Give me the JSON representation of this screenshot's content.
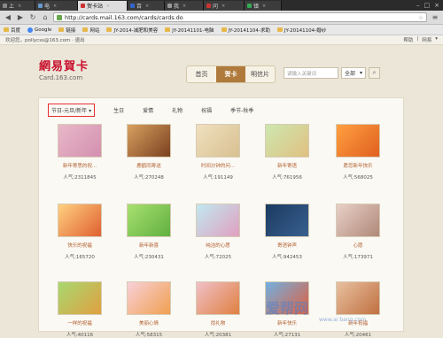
{
  "browser": {
    "tabs": [
      {
        "label": "上",
        "favicon_color": "#888888",
        "active": false
      },
      {
        "label": "电",
        "favicon_color": "#6699cc",
        "active": false
      },
      {
        "label": "贺卡站",
        "favicon_color": "#cc3333",
        "active": true
      },
      {
        "label": "百",
        "favicon_color": "#3366cc",
        "active": false
      },
      {
        "label": "我",
        "favicon_color": "#999999",
        "active": false
      },
      {
        "label": "问",
        "favicon_color": "#cc3333",
        "active": false
      },
      {
        "label": "镇",
        "favicon_color": "#33aa55",
        "active": false
      }
    ],
    "url": "http://cards.mail.163.com/cards/cards.do",
    "bookmarks": [
      {
        "label": "百度",
        "icon": "folder-icon"
      },
      {
        "label": "Google",
        "icon": "google-icon"
      },
      {
        "label": "链接",
        "icon": "folder-icon"
      },
      {
        "label": "网站",
        "icon": "folder-icon"
      },
      {
        "label": "JY-2014-减肥和美容",
        "icon": "folder-icon"
      },
      {
        "label": "JY-20141101-电脑",
        "icon": "folder-icon"
      },
      {
        "label": "JY-20141104-求助",
        "icon": "folder-icon"
      },
      {
        "label": "JY-20141104-婚纱",
        "icon": "folder-icon"
      }
    ]
  },
  "page": {
    "welcome": "欢迎您，pollycss@163.com · 退出",
    "top_links": [
      "帮助",
      "|",
      "网易",
      "▾"
    ],
    "logo_text": "網易賀卡",
    "logo_domain": "Card.163.com",
    "nav": [
      "首页",
      "贺卡",
      "明信片"
    ],
    "active_nav": 1,
    "search_placeholder": "请输入关键词",
    "search_scope": "全部",
    "categories": [
      "节日-元旦/新年 ▾",
      "生日",
      "爱情",
      "礼物",
      "祝福",
      "季节-秋季"
    ],
    "active_category": 0,
    "cards": [
      {
        "title": "新年寄思的祝...",
        "pop": "人气:2311845",
        "c1": "#e8b8c8",
        "c2": "#d490b0"
      },
      {
        "title": "鹿鹤同寿送",
        "pop": "人气:270248",
        "c1": "#d8a060",
        "c2": "#7a4020"
      },
      {
        "title": "时间分钟的问...",
        "pop": "人气:191149",
        "c1": "#f0e0c0",
        "c2": "#d8c090"
      },
      {
        "title": "新年寄语",
        "pop": "人气:761956",
        "c1": "#cde8b0",
        "c2": "#e0c080"
      },
      {
        "title": "愿您新年快乐",
        "pop": "人气:568025",
        "c1": "#ffa040",
        "c2": "#e06020"
      },
      {
        "title": "快乐的祝福",
        "pop": "人气:165720",
        "c1": "#ffd080",
        "c2": "#e06030"
      },
      {
        "title": "新年新喜",
        "pop": "人气:230431",
        "c1": "#a8e070",
        "c2": "#60b040"
      },
      {
        "title": "纯洁的心愿",
        "pop": "人气:72025",
        "c1": "#c0e8f0",
        "c2": "#e0a0c0"
      },
      {
        "title": "寄语钟声",
        "pop": "人气:942453",
        "c1": "#1a3a60",
        "c2": "#3a6090"
      },
      {
        "title": "心愿",
        "pop": "人气:173971",
        "c1": "#e8d0c8",
        "c2": "#b08878"
      },
      {
        "title": "一样的祝福",
        "pop": "人气:40116",
        "c1": "#a8d870",
        "c2": "#e0a040"
      },
      {
        "title": "美丽心情",
        "pop": "人气:58315",
        "c1": "#f8d0d8",
        "c2": "#f0a050"
      },
      {
        "title": "找礼物",
        "pop": "人气:20381",
        "c1": "#f0c0c8",
        "c2": "#e08040"
      },
      {
        "title": "新年快乐",
        "pop": "人气:27131",
        "c1": "#70b0e0",
        "c2": "#e06040"
      },
      {
        "title": "新年祝福",
        "pop": "人气:20461",
        "c1": "#e8c0a0",
        "c2": "#c07040"
      }
    ],
    "watermark": "爱帮网",
    "watermark_sub": "www.ai bang.com"
  }
}
